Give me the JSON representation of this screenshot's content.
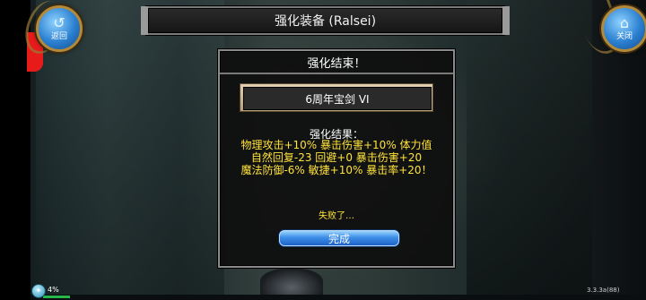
{
  "header": {
    "title": "强化装备 (Ralsei)"
  },
  "nav": {
    "back_label": "返回",
    "close_label": "关闭"
  },
  "dialog": {
    "title": "强化结束！",
    "item_name": "6周年宝剑 VI",
    "result_title": "强化结果：",
    "result_lines": [
      "物理攻击+10% 暴击伤害+10% 体力值",
      "自然回复-23 回避+0 暴击伤害+20",
      "魔法防御-6% 敏捷+10% 暴击率+20！"
    ],
    "status": "失败了…",
    "confirm_label": "完成"
  },
  "footer": {
    "exp_percent": "4%",
    "version": "3.3.3a(88)"
  },
  "colors": {
    "result_text": "#ffe23a",
    "button_blue": "#3d8fe8",
    "frame_gold": "#b28a3a"
  },
  "icons": {
    "back": "back-arrow-icon",
    "close": "home-icon"
  }
}
